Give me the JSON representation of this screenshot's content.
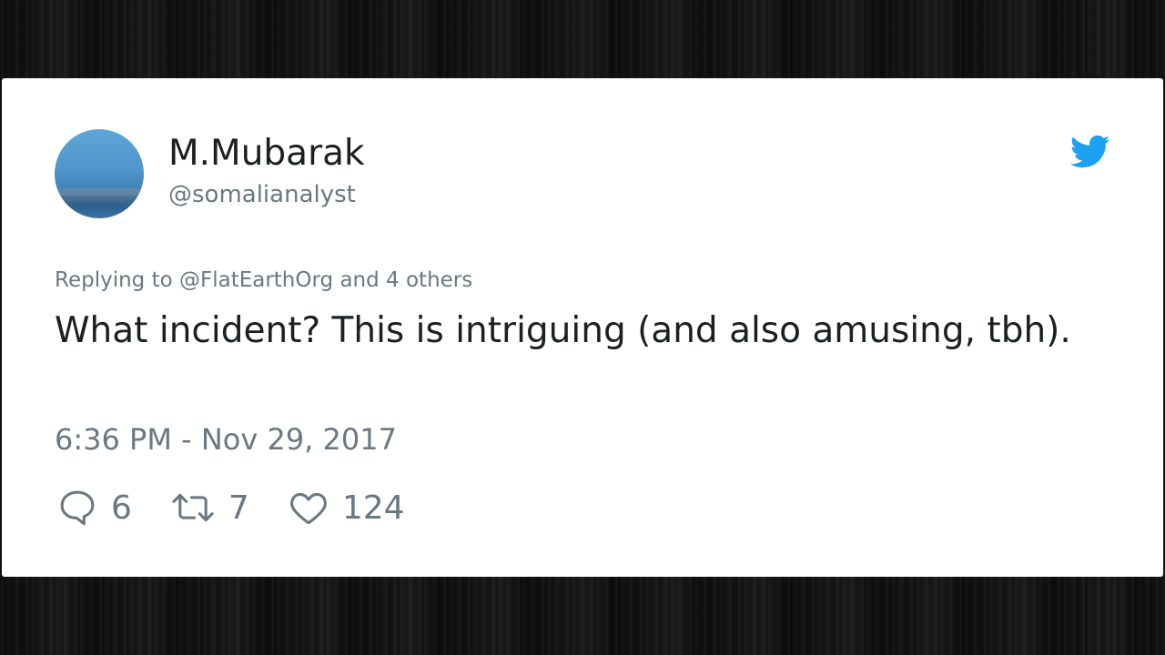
{
  "tweet": {
    "display_name": "M.Mubarak",
    "handle": "@somalianalyst",
    "replying_to": "Replying to @FlatEarthOrg and 4 others",
    "text": "What incident? This is intriguing (and also amusing, tbh).",
    "timestamp": "6:36 PM - Nov 29, 2017"
  },
  "actions": {
    "replies": "6",
    "retweets": "7",
    "likes": "124"
  },
  "icons": {
    "brand": "twitter-bird-icon",
    "reply": "reply-bubble-icon",
    "retweet": "retweet-arrows-icon",
    "like": "heart-icon"
  },
  "colors": {
    "brand": "#1da1f2",
    "text": "#1c2022",
    "secondary": "#697882",
    "card": "#ffffff"
  }
}
